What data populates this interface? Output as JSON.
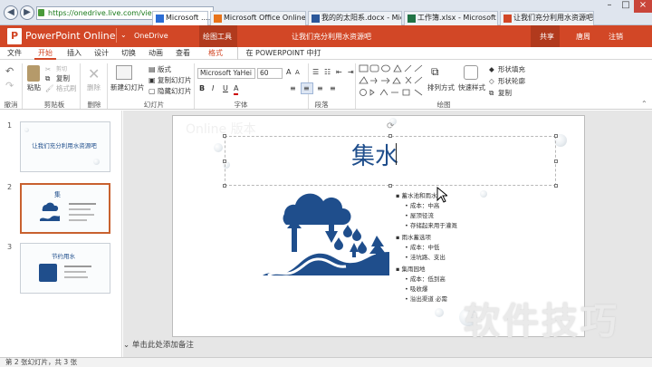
{
  "browser": {
    "address": "https://onedrive.live.com/vie",
    "tabs": [
      {
        "label": "Microsoft ...",
        "active": true
      },
      {
        "label": "Microsoft Office Online - ..."
      },
      {
        "label": "我的的太阳系.docx - Micro..."
      },
      {
        "label": "工作簿.xlsx - Microsoft Ex..."
      },
      {
        "label": "让我们充分利用水资源吧..."
      }
    ]
  },
  "titlebar": {
    "app": "PowerPoint Online",
    "onedrive": "OneDrive",
    "tool_tab": "绘图工具",
    "doc_title": "让我们充分利用水资源吧",
    "share": "共享",
    "user": "唐周",
    "signout": "注销"
  },
  "ribbon_tabs": [
    "文件",
    "开始",
    "插入",
    "设计",
    "切换",
    "动画",
    "查看",
    "格式"
  ],
  "open_in_ppt": "在 POWERPOINT 中打开",
  "ribbon": {
    "undo": "撤消",
    "paste": "粘贴",
    "cut": "剪切",
    "copy": "复制",
    "format_painter": "格式刷",
    "clipboard": "剪贴板",
    "delete": "删除",
    "delete_group": "删除",
    "new_slide": "新建幻灯片",
    "layout": "版式",
    "duplicate_slide": "复制幻灯片",
    "hide_slide": "隐藏幻灯片",
    "slides_group": "幻灯片",
    "font_name": "Microsoft YaHei U",
    "font_size": "60",
    "font_group": "字体",
    "paragraph_group": "段落",
    "arrange": "排列方式",
    "quick_styles": "快速样式",
    "shape_fill": "形状填充",
    "shape_outline": "形状轮廓",
    "duplicate": "复制",
    "drawing_group": "绘图"
  },
  "slides": [
    {
      "num": "1",
      "title": "让我们充分利用水资源吧"
    },
    {
      "num": "2",
      "title": "集"
    },
    {
      "num": "3",
      "title": "节约用水"
    }
  ],
  "slide": {
    "title": "集水",
    "bullets": [
      {
        "text": "蓄水池和雨水",
        "level": 1
      },
      {
        "text": "成本：中高",
        "level": 2
      },
      {
        "text": "屋顶径流",
        "level": 2
      },
      {
        "text": "存储起来用于灌溉",
        "level": 2
      },
      {
        "text": "雨水蓄选项",
        "level": 1
      },
      {
        "text": "成本：中低",
        "level": 2
      },
      {
        "text": "洼坑路、支出",
        "level": 2
      },
      {
        "text": "集雨园地",
        "level": 1
      },
      {
        "text": "成本：低到高",
        "level": 2
      },
      {
        "text": "吸收爆",
        "level": 2
      },
      {
        "text": "溢出渠道 必需",
        "level": 2
      }
    ],
    "bg_text": "Online 版本"
  },
  "notes_placeholder": "单击此处添加备注",
  "status": "第 2 张幻灯片，共 3 张",
  "watermark": "软件技巧",
  "colors": {
    "accent": "#d24726",
    "icon_blue": "#1f4e8c"
  }
}
